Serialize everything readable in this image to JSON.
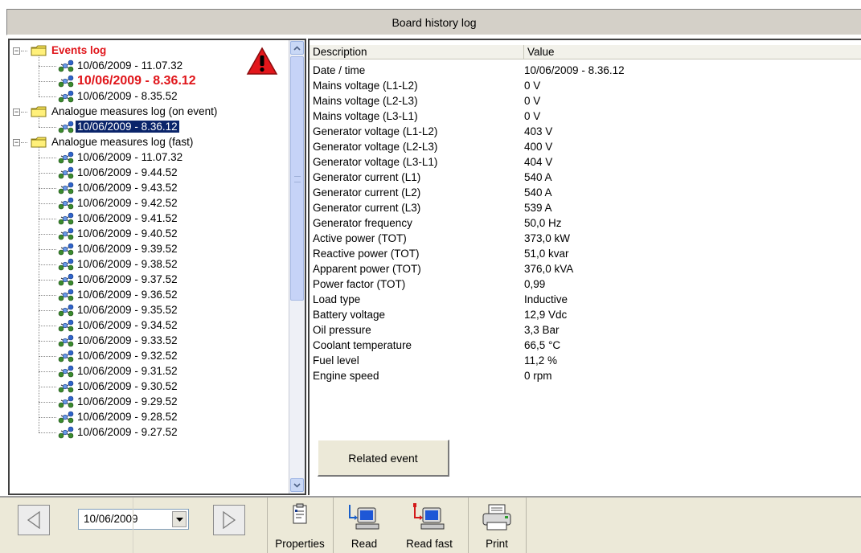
{
  "window": {
    "title": "Board history log"
  },
  "tree": {
    "events_log": {
      "label": "Events log",
      "items": [
        "10/06/2009 - 11.07.32",
        "10/06/2009 - 8.36.12",
        "10/06/2009 - 8.35.52"
      ]
    },
    "analogue_event": {
      "label": "Analogue measures log (on event)",
      "items": [
        "10/06/2009 - 8.36.12"
      ]
    },
    "analogue_fast": {
      "label": "Analogue measures log (fast)",
      "items": [
        "10/06/2009 - 11.07.32",
        "10/06/2009 - 9.44.52",
        "10/06/2009 - 9.43.52",
        "10/06/2009 - 9.42.52",
        "10/06/2009 - 9.41.52",
        "10/06/2009 - 9.40.52",
        "10/06/2009 - 9.39.52",
        "10/06/2009 - 9.38.52",
        "10/06/2009 - 9.37.52",
        "10/06/2009 - 9.36.52",
        "10/06/2009 - 9.35.52",
        "10/06/2009 - 9.34.52",
        "10/06/2009 - 9.33.52",
        "10/06/2009 - 9.32.52",
        "10/06/2009 - 9.31.52",
        "10/06/2009 - 9.30.52",
        "10/06/2009 - 9.29.52",
        "10/06/2009 - 9.28.52",
        "10/06/2009 - 9.27.52"
      ]
    }
  },
  "details": {
    "columns": {
      "description": "Description",
      "value": "Value"
    },
    "rows": [
      {
        "d": "Date / time",
        "v": "10/06/2009 - 8.36.12"
      },
      {
        "d": "Mains voltage (L1-L2)",
        "v": "0 V"
      },
      {
        "d": "Mains voltage (L2-L3)",
        "v": "0 V"
      },
      {
        "d": "Mains voltage (L3-L1)",
        "v": "0 V"
      },
      {
        "d": "Generator voltage (L1-L2)",
        "v": "403 V"
      },
      {
        "d": "Generator voltage (L2-L3)",
        "v": "400 V"
      },
      {
        "d": "Generator voltage (L3-L1)",
        "v": "404 V"
      },
      {
        "d": "Generator current (L1)",
        "v": "540 A"
      },
      {
        "d": "Generator current (L2)",
        "v": "540 A"
      },
      {
        "d": "Generator current (L3)",
        "v": "539 A"
      },
      {
        "d": "Generator frequency",
        "v": "50,0 Hz"
      },
      {
        "d": "Active power (TOT)",
        "v": "373,0 kW"
      },
      {
        "d": "Reactive power (TOT)",
        "v": "51,0 kvar"
      },
      {
        "d": "Apparent power (TOT)",
        "v": "376,0 kVA"
      },
      {
        "d": "Power factor (TOT)",
        "v": "0,99"
      },
      {
        "d": "Load type",
        "v": "Inductive"
      },
      {
        "d": "Battery voltage",
        "v": "12,9 Vdc"
      },
      {
        "d": "Oil pressure",
        "v": "3,3 Bar"
      },
      {
        "d": "Coolant temperature",
        "v": "66,5 °C"
      },
      {
        "d": "Fuel level",
        "v": "11,2 %"
      },
      {
        "d": "Engine speed",
        "v": "0 rpm"
      }
    ],
    "related_button": "Related event"
  },
  "toolbar": {
    "date": "10/06/2009",
    "properties": "Properties",
    "read": "Read",
    "read_fast": "Read fast",
    "print": "Print"
  },
  "colors": {
    "highlight": "#e0151a",
    "selection": "#0a246a",
    "panel": "#ece9d8"
  }
}
